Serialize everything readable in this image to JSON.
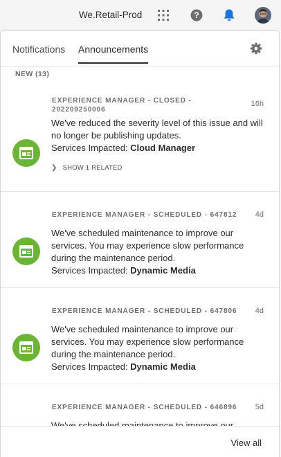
{
  "topbar": {
    "org_name": "We.Retail-Prod",
    "icons": [
      "apps-grid-icon",
      "help-icon",
      "bell-icon",
      "user-avatar"
    ]
  },
  "tabs": [
    {
      "label": "Notifications",
      "selected": false
    },
    {
      "label": "Announcements",
      "selected": true
    }
  ],
  "section_heading": "NEW (13)",
  "cards": [
    {
      "title": "EXPERIENCE MANAGER - CLOSED - 202209250006",
      "time": "16h",
      "body": "We've reduced the severity level of this issue and will no longer be publishing updates.",
      "services_label": "Services Impacted:",
      "services_value": "Cloud Manager",
      "related": "SHOW 1 RELATED"
    },
    {
      "title": "EXPERIENCE MANAGER - SCHEDULED - 647812",
      "time": "4d",
      "body": "We've scheduled maintenance to improve our services. You may experience slow performance during the maintenance period.",
      "services_label": "Services Impacted:",
      "services_value": "Dynamic Media"
    },
    {
      "title": "EXPERIENCE MANAGER - SCHEDULED - 647806",
      "time": "4d",
      "body": "We've scheduled maintenance to improve our services. You may experience slow performance during the maintenance period.",
      "services_label": "Services Impacted:",
      "services_value": "Dynamic Media"
    },
    {
      "title": "EXPERIENCE MANAGER - SCHEDULED - 646896",
      "time": "5d",
      "body": "We've scheduled maintenance to improve our"
    }
  ],
  "footer": {
    "view_all": "View all"
  },
  "colors": {
    "accent_blue": "#1473e6",
    "icon_green": "#6bb536"
  }
}
